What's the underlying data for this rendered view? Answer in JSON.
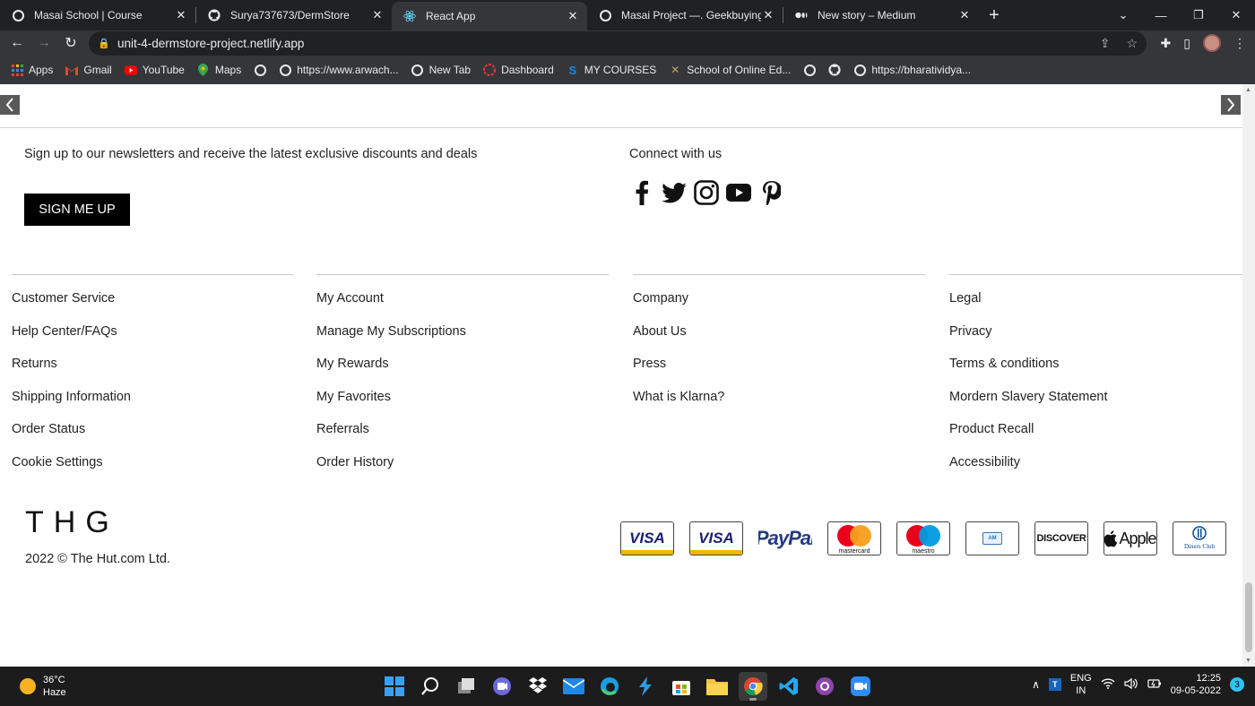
{
  "browser": {
    "tabs": [
      {
        "title": "Masai School | Course",
        "icon": "globe-icon",
        "active": false
      },
      {
        "title": "Surya737673/DermStore",
        "icon": "github-icon",
        "active": false
      },
      {
        "title": "React App",
        "icon": "react-icon",
        "active": true
      },
      {
        "title": "Masai Project —. Geekbuying.com",
        "icon": "globe-icon",
        "active": false
      },
      {
        "title": "New story – Medium",
        "icon": "medium-icon",
        "active": false
      }
    ],
    "url": "unit-4-dermstore-project.netlify.app",
    "bookmarks": [
      {
        "label": "Apps",
        "icon": "apps-grid-icon"
      },
      {
        "label": "Gmail",
        "icon": "gmail-icon"
      },
      {
        "label": "YouTube",
        "icon": "youtube-icon"
      },
      {
        "label": "Maps",
        "icon": "maps-icon"
      },
      {
        "label": "",
        "icon": "globe-icon"
      },
      {
        "label": "https://www.arwach...",
        "icon": "globe-icon"
      },
      {
        "label": "New Tab",
        "icon": "globe-icon"
      },
      {
        "label": "Dashboard",
        "icon": "dashboard-icon"
      },
      {
        "label": "MY COURSES",
        "icon": "courses-icon"
      },
      {
        "label": "School of Online Ed...",
        "icon": "school-icon"
      },
      {
        "label": "",
        "icon": "globe-icon"
      },
      {
        "label": "",
        "icon": "github-icon"
      },
      {
        "label": "https://bharatividya...",
        "icon": "globe-icon"
      }
    ]
  },
  "footer": {
    "newsletter_text": "Sign up to our newsletters and receive the latest exclusive discounts and deals",
    "signup_label": "SIGN ME UP",
    "connect_text": "Connect with us",
    "social": [
      "facebook-icon",
      "twitter-icon",
      "instagram-icon",
      "youtube-icon",
      "pinterest-icon"
    ],
    "columns": [
      {
        "links": [
          "Customer Service",
          "Help Center/FAQs",
          "Returns",
          "Shipping Information",
          "Order Status",
          "Cookie Settings"
        ]
      },
      {
        "links": [
          "My Account",
          "Manage My Subscriptions",
          "My Rewards",
          "My Favorites",
          "Referrals",
          "Order History"
        ]
      },
      {
        "links": [
          "Company",
          "About Us",
          "Press",
          "What is Klarna?"
        ]
      },
      {
        "links": [
          "Legal",
          "Privacy",
          "Terms & conditions",
          "Mordern Slavery Statement",
          "Product Recall",
          "Accessibility"
        ]
      }
    ],
    "logo": "THG",
    "copyright": "2022 © The Hut.com Ltd.",
    "payments": [
      {
        "name": "visa",
        "label": "VISA"
      },
      {
        "name": "visa-debit",
        "label": "VISA"
      },
      {
        "name": "paypal",
        "label": "PayPal"
      },
      {
        "name": "mastercard",
        "label": "mastercard"
      },
      {
        "name": "maestro",
        "label": "maestro"
      },
      {
        "name": "amex",
        "label": ""
      },
      {
        "name": "discover",
        "label": "DISCOVER"
      },
      {
        "name": "apple-pay",
        "label": "Apple"
      },
      {
        "name": "diners-club",
        "label": "Diners Club"
      }
    ]
  },
  "taskbar": {
    "temperature": "36°C",
    "weather": "Haze",
    "lang_top": "ENG",
    "lang_bottom": "IN",
    "time": "12:25",
    "date": "09-05-2022",
    "notifications": "3"
  }
}
